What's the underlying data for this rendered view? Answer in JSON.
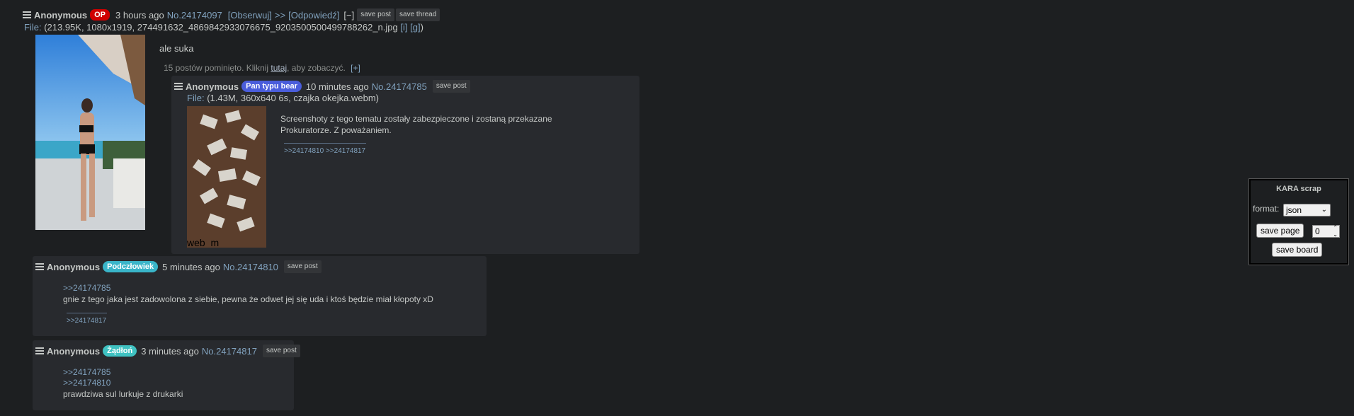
{
  "op": {
    "name": "Anonymous",
    "badge": "OP",
    "time": "3 hours ago",
    "number": "No.24174097",
    "watch": "[Obserwuj]",
    "reply_sep": ">>",
    "reply": "[Odpowiedź]",
    "collapse": "[−]",
    "save_post": "save post",
    "save_thread": "save thread",
    "file_label": "File:",
    "file_info": "(213.95K, 1080x1919, 274491632_4869842933076675_9203500500499788262_n.jpg",
    "file_i": "[i]",
    "file_g": "[g]",
    "file_close": ")",
    "comment": "ale suka",
    "omitted_pre": "15 postów pominięto. Kliknij ",
    "omitted_link": "tutaj",
    "omitted_post": ", aby zobaczyć.",
    "omitted_expand": "[+]"
  },
  "posts": [
    {
      "name": "Anonymous",
      "badge": "Pan typu bear",
      "time": "10 minutes ago",
      "number": "No.24174785",
      "save_post": "save post",
      "file_label": "File:",
      "file_info": "(1.43M, 360x640 6s, czajka okejka.webm)",
      "thumb_caption": "web_m",
      "comment_line1": "Screenshoty z tego tematu zostały zabezpieczone i zostaną przekazane",
      "comment_line2": "Prokuratorze. Z poważaniem.",
      "backlinks": ">>24174810 >>24174817"
    },
    {
      "name": "Anonymous",
      "badge": "Podczłowiek",
      "time": "5 minutes ago",
      "number": "No.24174810",
      "save_post": "save post",
      "quote1": ">>24174785",
      "comment": "gnie z tego jaka jest zadowolona z siebie, pewna że odwet jej się uda i ktoś będzie miał kłopoty xD",
      "backlinks": ">>24174817"
    },
    {
      "name": "Anonymous",
      "badge": "Żądłoń",
      "time": "3 minutes ago",
      "number": "No.24174817",
      "save_post": "save post",
      "quote1": ">>24174785",
      "quote2": ">>24174810",
      "comment": "prawdziwa sul lurkuje z drukarki"
    }
  ],
  "widget": {
    "title": "KARA scrap",
    "format_label": "format:",
    "format_value": "json",
    "save_page": "save page",
    "page_value": "0",
    "save_board": "save board"
  },
  "colors": {
    "link": "#81a2be",
    "background": "#1d1f21",
    "reply_bg": "#282a2e",
    "op_badge": "#d00000"
  }
}
